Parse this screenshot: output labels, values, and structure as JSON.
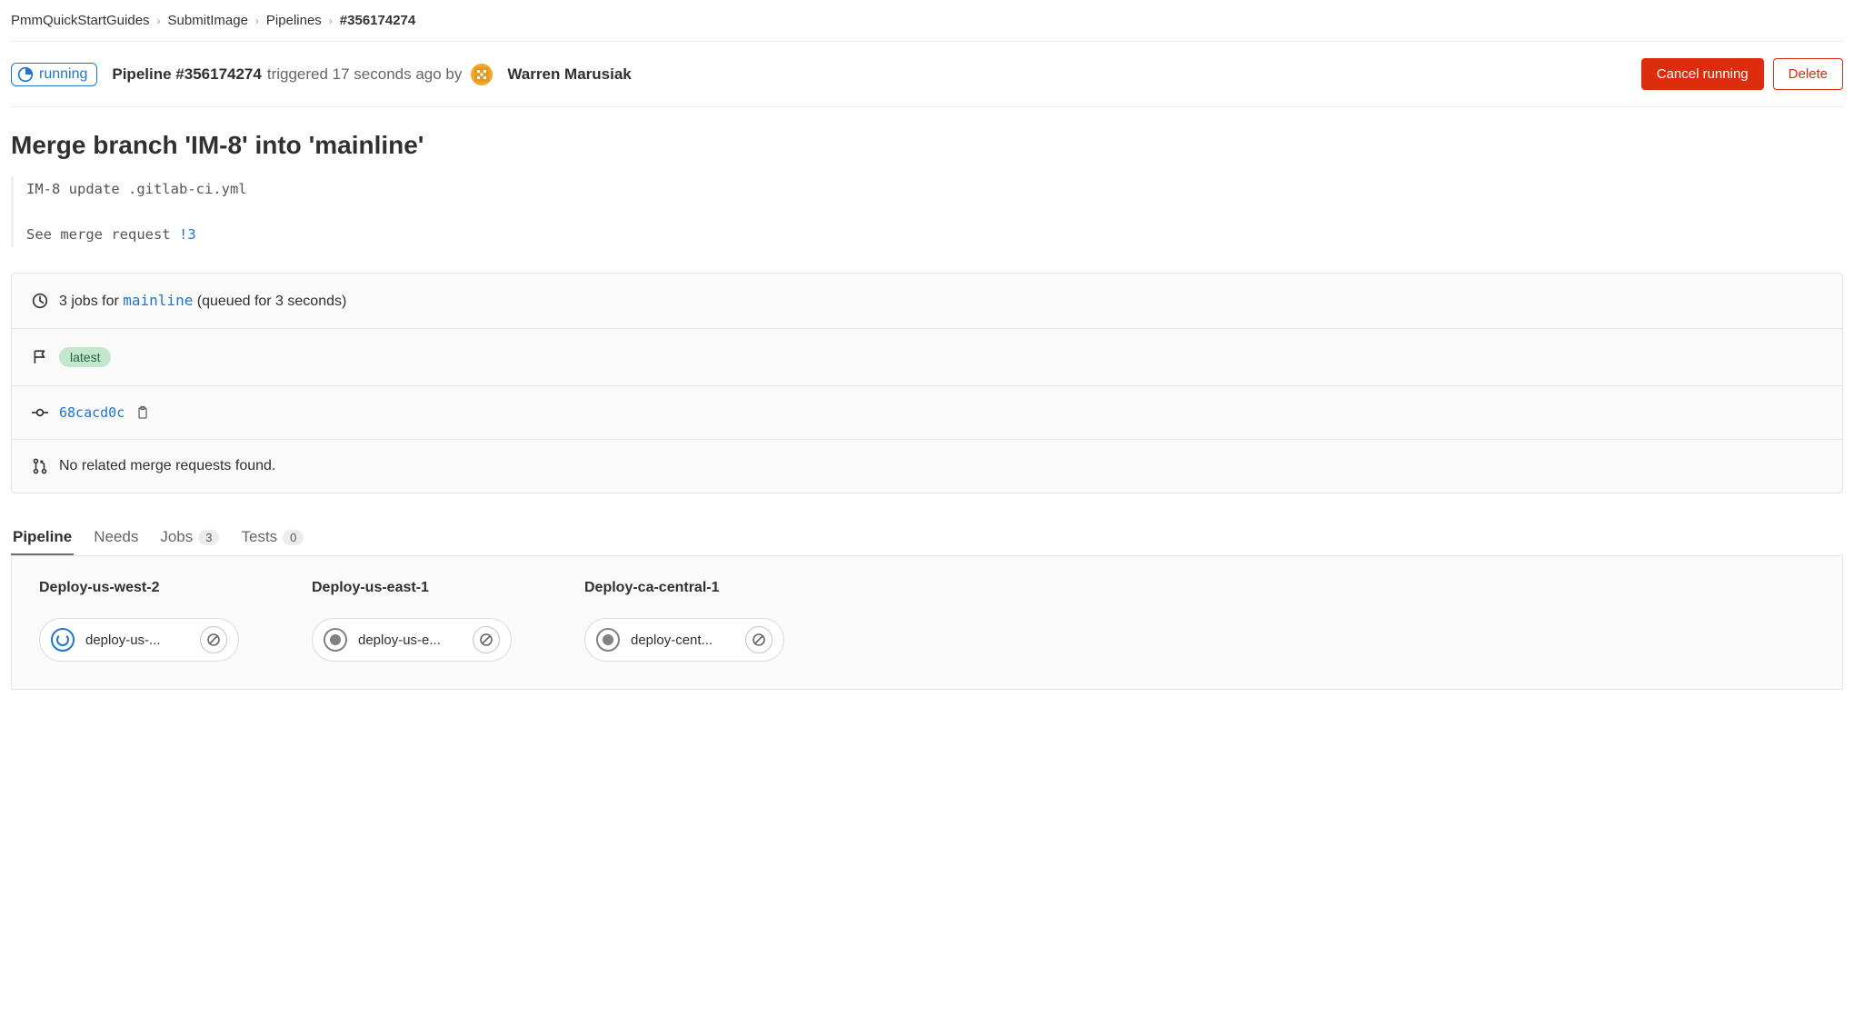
{
  "breadcrumbs": {
    "items": [
      "PmmQuickStartGuides",
      "SubmitImage",
      "Pipelines",
      "#356174274"
    ]
  },
  "header": {
    "status_label": "running",
    "pipeline_prefix": "Pipeline ",
    "pipeline_id": "#356174274",
    "triggered_text": " triggered 17 seconds ago by",
    "author": "Warren Marusiak",
    "cancel_label": "Cancel running",
    "delete_label": "Delete"
  },
  "commit": {
    "title": "Merge branch 'IM-8' into 'mainline'",
    "desc_line1": "IM-8 update .gitlab-ci.yml",
    "desc_line2_prefix": "See merge request ",
    "mr_ref": "!3"
  },
  "info": {
    "jobs_count": "3",
    "jobs_text_prefix": " jobs for ",
    "branch": "mainline",
    "queued_text": " (queued for 3 seconds)",
    "latest_tag": "latest",
    "commit_sha": "68cacd0c",
    "no_mr_text": "No related merge requests found."
  },
  "tabs": {
    "pipeline": "Pipeline",
    "needs": "Needs",
    "jobs": "Jobs",
    "jobs_count": "3",
    "tests": "Tests",
    "tests_count": "0"
  },
  "stages": [
    {
      "name": "Deploy-us-west-2",
      "job": {
        "label": "deploy-us-...",
        "status": "running"
      }
    },
    {
      "name": "Deploy-us-east-1",
      "job": {
        "label": "deploy-us-e...",
        "status": "created"
      }
    },
    {
      "name": "Deploy-ca-central-1",
      "job": {
        "label": "deploy-cent...",
        "status": "created"
      }
    }
  ]
}
